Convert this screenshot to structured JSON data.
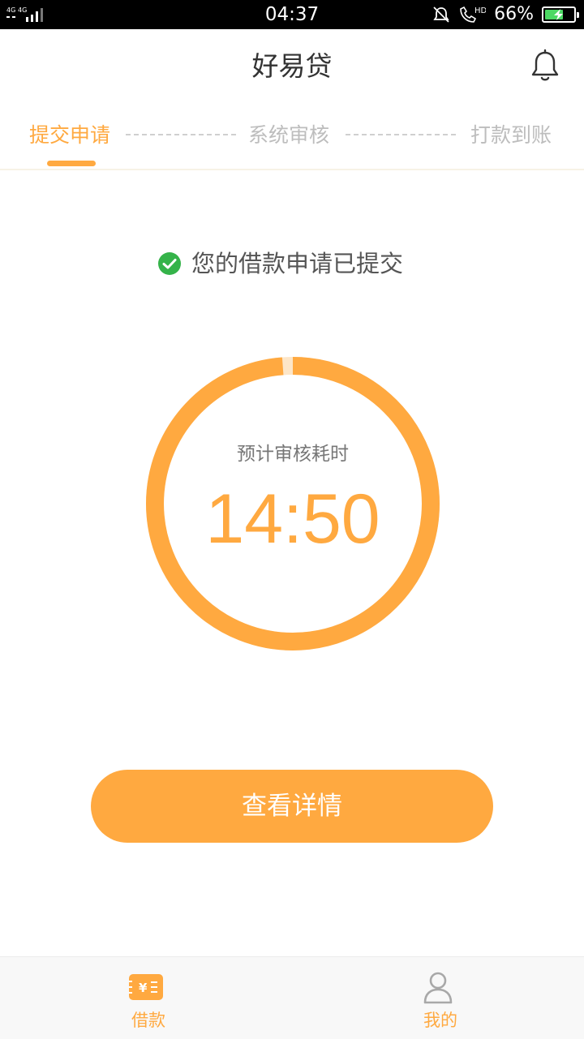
{
  "status_bar": {
    "network_label_1": "4G",
    "network_label_2": "4G",
    "time": "04:37",
    "hd_label": "HD",
    "battery": "66%",
    "battery_level": 0.66,
    "battery_color": "#4cd964"
  },
  "header": {
    "title": "好易贷",
    "bell_icon": "bell-icon"
  },
  "steps": {
    "items": [
      {
        "label": "提交申请",
        "active": true
      },
      {
        "label": "系统审核",
        "active": false
      },
      {
        "label": "打款到账",
        "active": false
      }
    ]
  },
  "status": {
    "icon": "check-circle-icon",
    "message": "您的借款申请已提交"
  },
  "timer": {
    "label": "预计审核耗时",
    "value": "14:50",
    "progress": 0.988
  },
  "actions": {
    "detail_label": "查看详情"
  },
  "tabs": {
    "items": [
      {
        "label": "借款",
        "icon": "loan-icon",
        "active": true
      },
      {
        "label": "我的",
        "icon": "user-icon",
        "active": false
      }
    ]
  },
  "colors": {
    "accent": "#ffa940",
    "success": "#35b34a",
    "inactive_text": "#bdbdbd"
  }
}
